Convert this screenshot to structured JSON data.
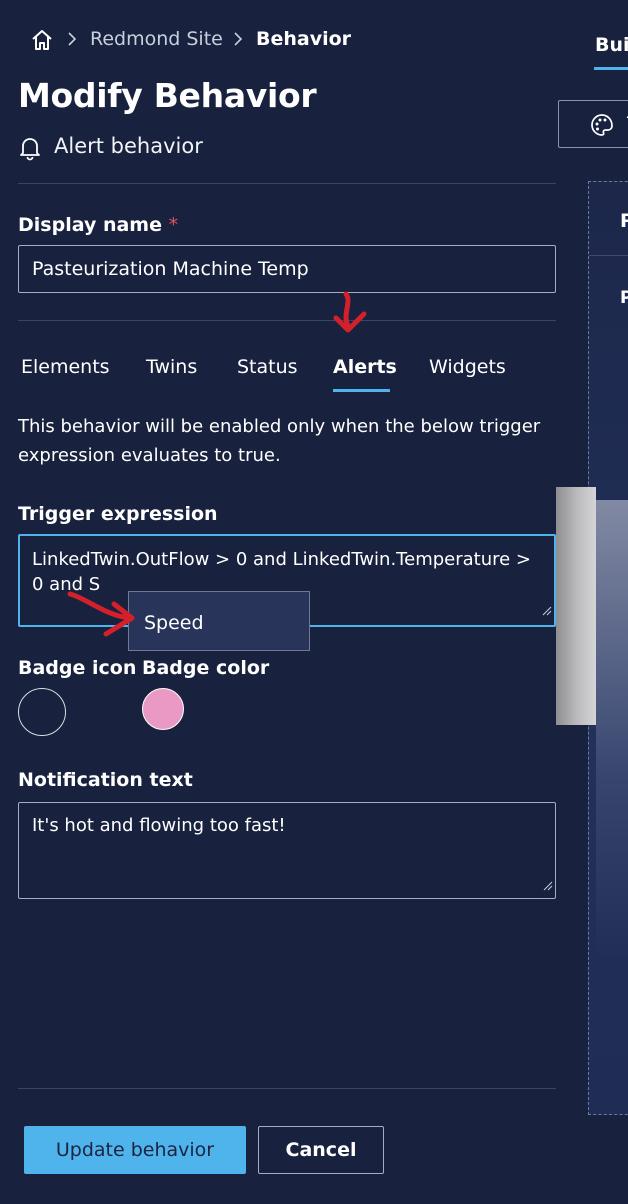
{
  "breadcrumb": {
    "site": "Redmond Site",
    "current": "Behavior"
  },
  "page": {
    "title": "Modify Behavior",
    "subtitle": "Alert behavior"
  },
  "form": {
    "display_name_label": "Display name",
    "required_mark": "*",
    "display_name_value": "Pasteurization Machine Temp"
  },
  "tabs": [
    {
      "label": "Elements",
      "active": false
    },
    {
      "label": "Twins",
      "active": false
    },
    {
      "label": "Status",
      "active": false
    },
    {
      "label": "Alerts",
      "active": true
    },
    {
      "label": "Widgets",
      "active": false
    }
  ],
  "alerts": {
    "description": "This behavior will be enabled only when the below trigger expression evaluates to true.",
    "trigger_label": "Trigger expression",
    "trigger_value": "LinkedTwin.OutFlow > 0 and LinkedTwin.Temperature > 0 and S",
    "suggestion": "Speed",
    "badge_icon_label": "Badge icon",
    "badge_color_label": "Badge color",
    "badge_color": "#ea98c4",
    "notification_label": "Notification text",
    "notification_value": "It's hot and flowing too fast!"
  },
  "footer": {
    "update_label": "Update behavior",
    "cancel_label": "Cancel"
  },
  "right_panel": {
    "tab_label": "Buil",
    "button_label": "T",
    "card_header": "P",
    "card_sub": "P"
  },
  "colors": {
    "accent": "#4fb3ec",
    "background": "#18213d",
    "annotation": "#d4202a"
  },
  "icons": {
    "home": "home-icon",
    "chevron": "chevron-right-icon",
    "bell": "bell-icon",
    "palette": "palette-icon"
  }
}
